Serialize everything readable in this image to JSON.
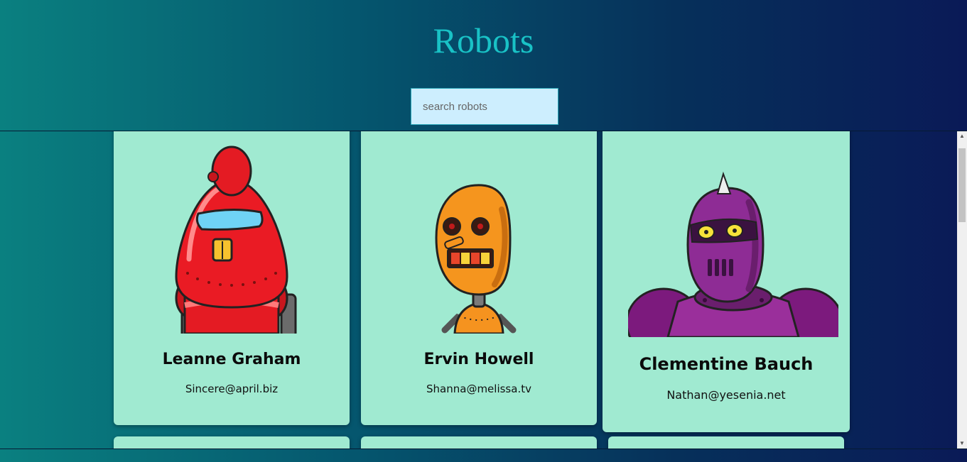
{
  "header": {
    "title": "Robots"
  },
  "search": {
    "placeholder": "search robots",
    "value": ""
  },
  "robots": [
    {
      "name": "Leanne Graham",
      "email": "Sincere@april.biz"
    },
    {
      "name": "Ervin Howell",
      "email": "Shanna@melissa.tv"
    },
    {
      "name": "Clementine Bauch",
      "email": "Nathan@yesenia.net"
    }
  ],
  "colors": {
    "card_bg": "#a0ead1",
    "title": "#19c2c6",
    "search_bg": "#cdeefe"
  },
  "icons": {
    "scroll_up": "triangle-up",
    "scroll_down": "triangle-down"
  }
}
